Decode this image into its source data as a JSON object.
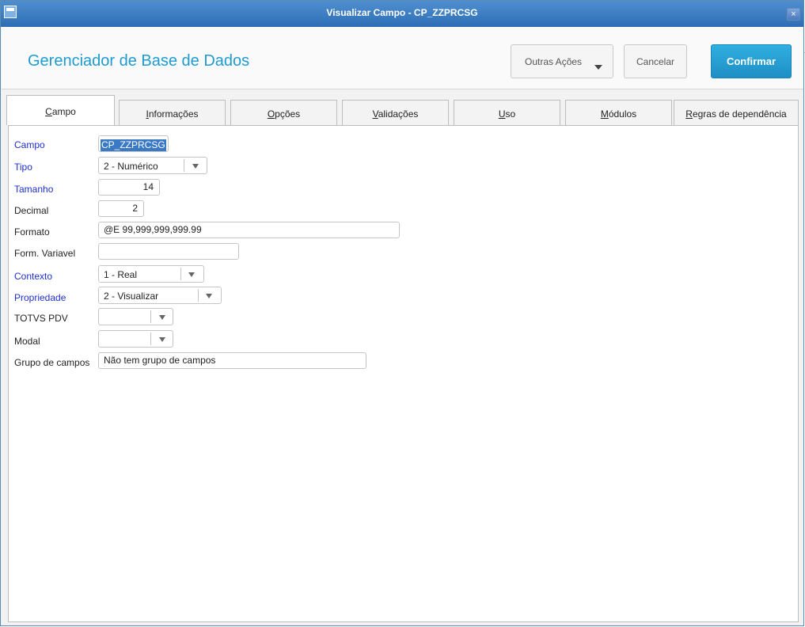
{
  "window": {
    "title": "Visualizar Campo - CP_ZZPRCSG",
    "close_glyph": "×",
    "behind_text": "s"
  },
  "header": {
    "app_title": "Gerenciador de Base de Dados",
    "other_actions_label": "Outras Ações",
    "cancel_label": "Cancelar",
    "confirm_label": "Confirmar"
  },
  "tabs": [
    {
      "label": "Campo",
      "active": true
    },
    {
      "label": "Informações"
    },
    {
      "label": "Opções"
    },
    {
      "label": "Validações"
    },
    {
      "label": "Uso"
    },
    {
      "label": "Módulos"
    },
    {
      "label": "Regras de dependência"
    }
  ],
  "form": {
    "campo": {
      "label": "Campo",
      "value": "CP_ZZPRCSG"
    },
    "tipo": {
      "label": "Tipo",
      "value": "2 - Numérico"
    },
    "tamanho": {
      "label": "Tamanho",
      "value": "14"
    },
    "decimal": {
      "label": "Decimal",
      "value": "2"
    },
    "formato": {
      "label": "Formato",
      "value": "@E 99,999,999,999.99"
    },
    "form_variavel": {
      "label": "Form. Variavel",
      "value": ""
    },
    "contexto": {
      "label": "Contexto",
      "value": "1 - Real"
    },
    "propriedade": {
      "label": "Propriedade",
      "value": "2 - Visualizar"
    },
    "totvs_pdv": {
      "label": "TOTVS PDV",
      "value": ""
    },
    "modal": {
      "label": "Modal",
      "value": ""
    },
    "grupo_campos": {
      "label": "Grupo de campos",
      "value": "Não tem grupo de campos"
    }
  },
  "colors": {
    "accent": "#1e9bd0",
    "confirm": "#1e8fc4",
    "required_label": "#1f2fd2",
    "titlebar": "#3a7cc4"
  }
}
